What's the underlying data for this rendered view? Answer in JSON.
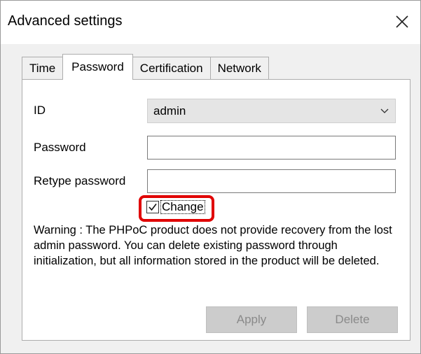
{
  "window": {
    "title": "Advanced settings"
  },
  "tabs": [
    {
      "label": "Time"
    },
    {
      "label": "Password"
    },
    {
      "label": "Certification"
    },
    {
      "label": "Network"
    }
  ],
  "active_tab": "Password",
  "form": {
    "id_label": "ID",
    "id_value": "admin",
    "password_label": "Password",
    "password_value": "",
    "retype_label": "Retype password",
    "retype_value": "",
    "change_label": "Change",
    "change_checked": true,
    "warning": "Warning : The PHPoC product does not provide recovery from the lost admin password. You can delete existing password through initialization, but all information stored in the product will be deleted."
  },
  "buttons": {
    "apply": "Apply",
    "delete": "Delete"
  },
  "colors": {
    "highlight": "#e00000",
    "disabled_button": "#cccccc",
    "disabled_text": "#8a8a8a"
  },
  "icons": [
    "close-icon",
    "chevron-down-icon",
    "checkmark-icon"
  ]
}
